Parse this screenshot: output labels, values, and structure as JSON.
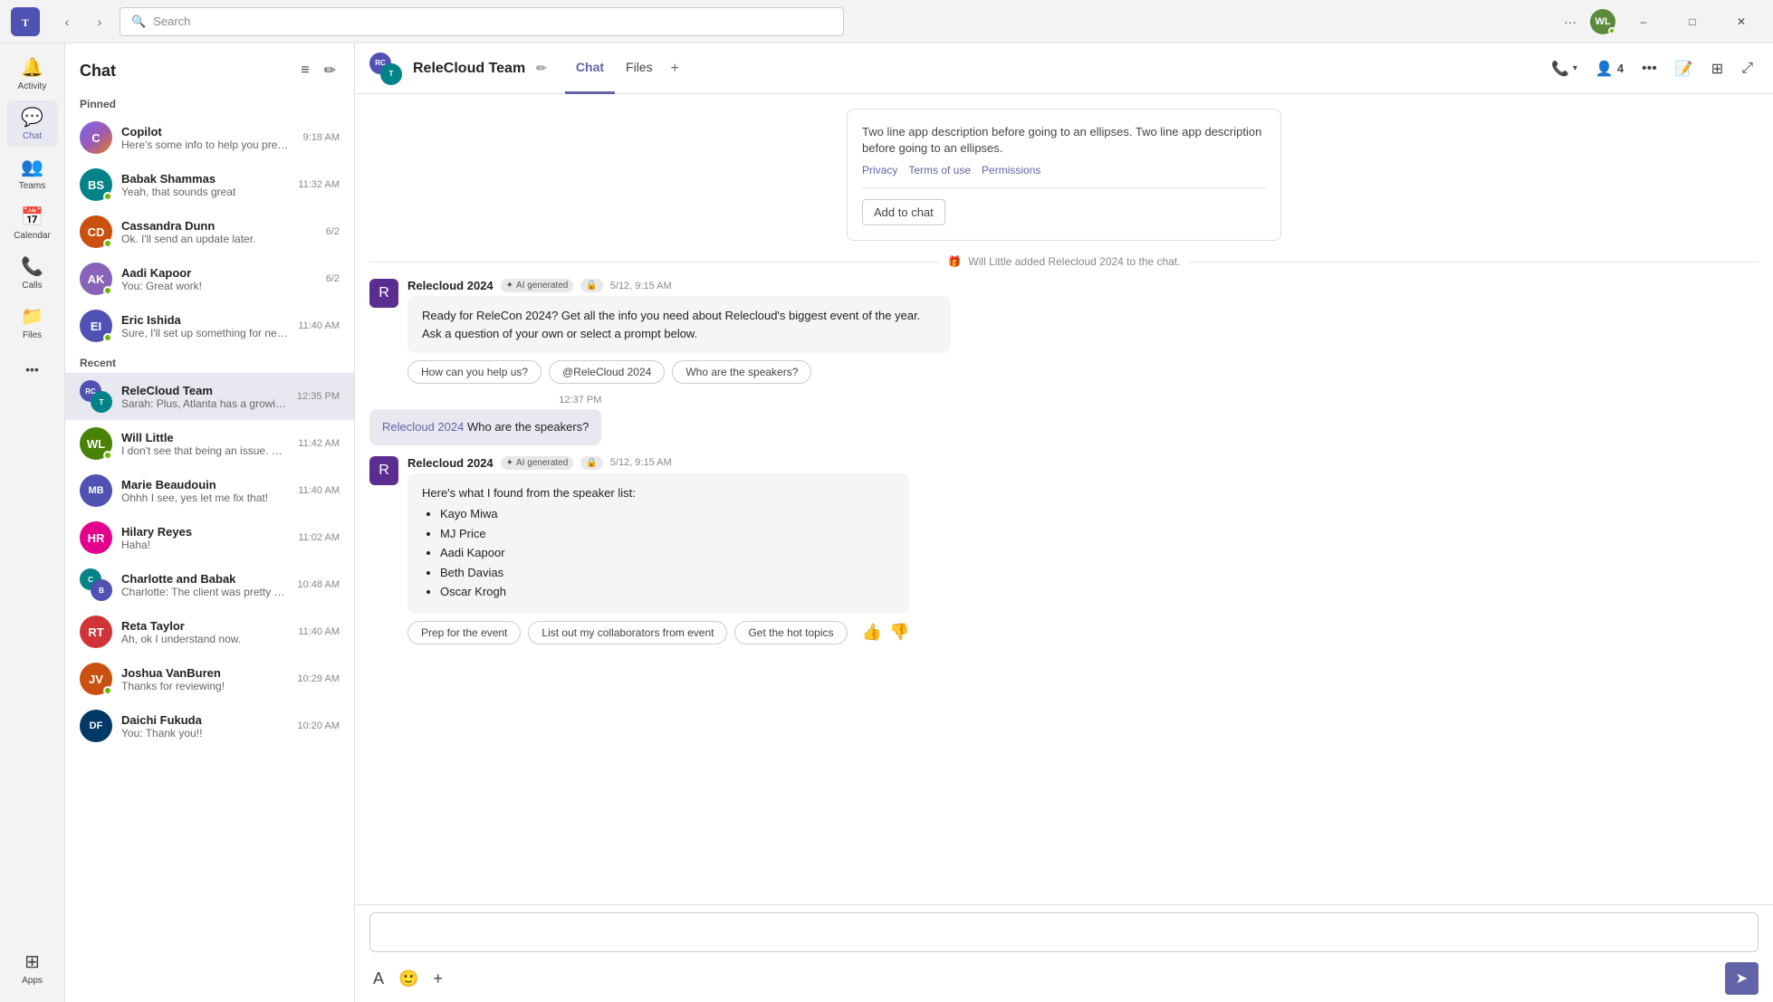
{
  "app": {
    "title": "Microsoft Teams",
    "logo": "T"
  },
  "titlebar": {
    "back_label": "‹",
    "forward_label": "›",
    "search_placeholder": "Search",
    "more_label": "···",
    "minimize_label": "–",
    "maximize_label": "□",
    "close_label": "✕",
    "user_initials": "WL"
  },
  "rail": {
    "items": [
      {
        "id": "activity",
        "label": "Activity",
        "icon": "🔔"
      },
      {
        "id": "chat",
        "label": "Chat",
        "icon": "💬",
        "active": true
      },
      {
        "id": "teams",
        "label": "Teams",
        "icon": "👥"
      },
      {
        "id": "calendar",
        "label": "Calendar",
        "icon": "📅"
      },
      {
        "id": "calls",
        "label": "Calls",
        "icon": "📞"
      },
      {
        "id": "files",
        "label": "Files",
        "icon": "📁"
      },
      {
        "id": "more",
        "label": "···",
        "icon": "···"
      },
      {
        "id": "apps",
        "label": "Apps",
        "icon": "⊞"
      }
    ]
  },
  "sidebar": {
    "title": "Chat",
    "filter_label": "≡",
    "compose_label": "✏",
    "pinned_label": "Pinned",
    "recent_label": "Recent",
    "pinned_chats": [
      {
        "id": "copilot",
        "name": "Copilot",
        "preview": "Here's some info to help you prep for your...",
        "time": "9:18 AM",
        "av_color": "copilot-avatar",
        "av_text": "C",
        "status": "none"
      },
      {
        "id": "babak",
        "name": "Babak Shammas",
        "preview": "Yeah, that sounds great",
        "time": "11:32 AM",
        "av_color": "av-teal",
        "av_text": "BS",
        "status": "online"
      },
      {
        "id": "cassandra",
        "name": "Cassandra Dunn",
        "preview": "Ok. I'll send an update later.",
        "time": "6/2",
        "av_color": "av-orange",
        "av_text": "CD",
        "status": "online"
      },
      {
        "id": "aadi",
        "name": "Aadi Kapoor",
        "preview": "You: Great work!",
        "time": "6/2",
        "av_color": "av-purple",
        "av_text": "AK",
        "status": "online"
      },
      {
        "id": "eric",
        "name": "Eric Ishida",
        "preview": "Sure, I'll set up something for next week t...",
        "time": "11:40 AM",
        "av_color": "av-blue",
        "av_text": "EI",
        "status": "online"
      }
    ],
    "recent_chats": [
      {
        "id": "relecloud-team",
        "name": "ReleCloud Team",
        "preview": "Sarah: Plus, Atlanta has a growing tech ...",
        "time": "12:35 PM",
        "av_color": "av-blue",
        "av_text": "RC",
        "status": "none",
        "is_group": true,
        "active": true
      },
      {
        "id": "will",
        "name": "Will Little",
        "preview": "I don't see that being an issue. Can you ta...",
        "time": "11:42 AM",
        "av_color": "av-green",
        "av_text": "WL",
        "status": "online"
      },
      {
        "id": "marie",
        "name": "Marie Beaudouin",
        "preview": "Ohhh I see, yes let me fix that!",
        "time": "11:40 AM",
        "av_color": "av-blue",
        "av_text": "MB",
        "status": "none",
        "initials_only": true
      },
      {
        "id": "hilary",
        "name": "Hilary Reyes",
        "preview": "Haha!",
        "time": "11:02 AM",
        "av_color": "av-pink",
        "av_text": "HR",
        "status": "none"
      },
      {
        "id": "charlotte-babak",
        "name": "Charlotte and Babak",
        "preview": "Charlotte: The client was pretty happy with...",
        "time": "10:48 AM",
        "av_color": "av-teal",
        "av_text": "CB",
        "status": "none",
        "is_group": true
      },
      {
        "id": "reta",
        "name": "Reta Taylor",
        "preview": "Ah, ok I understand now.",
        "time": "11:40 AM",
        "av_color": "av-red",
        "av_text": "RT",
        "status": "none"
      },
      {
        "id": "joshua",
        "name": "Joshua VanBuren",
        "preview": "Thanks for reviewing!",
        "time": "10:29 AM",
        "av_color": "av-orange",
        "av_text": "JV",
        "status": "online"
      },
      {
        "id": "daichi",
        "name": "Daichi Fukuda",
        "preview": "You: Thank you!!",
        "time": "10:20 AM",
        "av_color": "av-darkblue",
        "av_text": "DF",
        "status": "none"
      }
    ]
  },
  "chat": {
    "group_name": "ReleCloud Team",
    "tabs": [
      {
        "id": "chat",
        "label": "Chat",
        "active": true
      },
      {
        "id": "files",
        "label": "Files",
        "active": false
      }
    ],
    "participant_count": "4",
    "app_card": {
      "description": "Two line app description before going to an ellipses. Two line app description before going to an ellipses.",
      "link_privacy": "Privacy",
      "link_terms": "Terms of use",
      "link_permissions": "Permissions",
      "add_btn": "Add to chat"
    },
    "system_msg": "Will Little added Relecloud 2024 to the chat.",
    "bot_messages": [
      {
        "id": "msg1",
        "sender": "Relecloud 2024",
        "badge": "AI generated",
        "lock_icon": "🔒",
        "time": "5/12, 9:15 AM",
        "text": "Ready for ReleCon 2024? Get all the info you need about Relecloud's biggest event of the year. Ask a question of your own or select a prompt below.",
        "actions": [
          {
            "id": "how",
            "label": "How can you help us?"
          },
          {
            "id": "at",
            "label": "@ReleCloud 2024"
          },
          {
            "id": "speakers",
            "label": "Who are the speakers?"
          }
        ]
      },
      {
        "id": "msg2",
        "sender": "Relecloud 2024",
        "badge": "AI generated",
        "lock_icon": "🔒",
        "time": "5/12, 9:15 AM",
        "text_intro": "Here's what I found from the speaker list:",
        "speakers": [
          "Kayo Miwa",
          "MJ Price",
          "Aadi Kapoor",
          "Beth Davias",
          "Oscar Krogh"
        ],
        "actions": [
          {
            "id": "prep",
            "label": "Prep for the event"
          },
          {
            "id": "collaborators",
            "label": "List out my collaborators from event"
          },
          {
            "id": "topics",
            "label": "Get the hot topics"
          }
        ]
      }
    ],
    "right_message": {
      "time": "12:37 PM",
      "mention": "Relecloud 2024",
      "text": " Who are the speakers?"
    },
    "compose_placeholder": ""
  },
  "colors": {
    "accent": "#6264a7",
    "online": "#6bb700"
  }
}
